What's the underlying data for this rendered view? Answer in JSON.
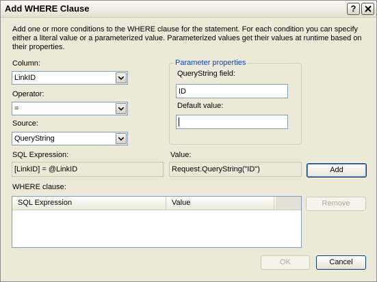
{
  "window": {
    "title": "Add WHERE Clause",
    "help_glyph": "?",
    "icons": [
      "help-icon",
      "close-icon"
    ]
  },
  "description": "Add one or more conditions to the WHERE clause for the statement. For each condition you can specify either a literal value or a parameterized value. Parameterized values get their values at runtime based on their properties.",
  "column": {
    "label": "Column:",
    "value": "LinkID"
  },
  "operator": {
    "label": "Operator:",
    "value": "="
  },
  "source": {
    "label": "Source:",
    "value": "QueryString"
  },
  "parameter": {
    "group_title": "Parameter properties",
    "querystring_label": "QueryString field:",
    "querystring_value": "ID",
    "default_label": "Default value:",
    "default_value": ""
  },
  "sql_expression": {
    "label": "SQL Expression:",
    "value": "[LinkID] = @LinkID"
  },
  "value_field": {
    "label": "Value:",
    "value": "Request.QueryString(\"ID\")"
  },
  "buttons": {
    "add": "Add",
    "remove": "Remove",
    "ok": "OK",
    "cancel": "Cancel"
  },
  "where_clause": {
    "label": "WHERE clause:",
    "columns": [
      "SQL Expression",
      "Value"
    ],
    "rows": []
  },
  "colors": {
    "accent": "#0046d5",
    "border": "#7f9db9",
    "background": "#ece9d8"
  }
}
